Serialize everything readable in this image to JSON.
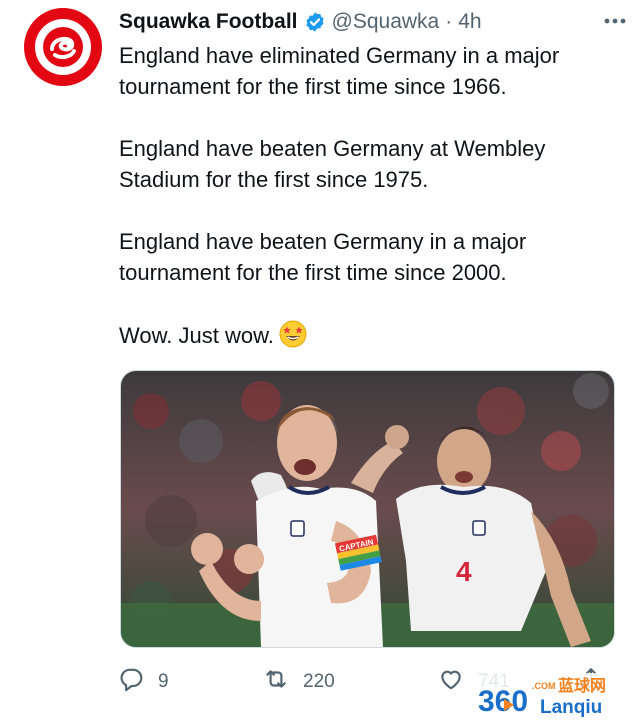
{
  "account": {
    "name": "Squawka Football",
    "handle": "@Squawka",
    "separator": "·",
    "time": "4h",
    "verified": true,
    "avatar_color": "#e30613"
  },
  "tweet": {
    "paragraphs": [
      "England have eliminated Germany in a major tournament for the first time since 1966.",
      "England have beaten Germany at Wembley Stadium for the first since 1975.",
      "England have beaten Germany in a major tournament for the first time since 2000.",
      "Wow. Just wow."
    ],
    "emoji": "star-struck-emoji"
  },
  "media": {
    "alt_icon": "photo-of-two-england-players-celebrating",
    "armband_text": "CAPTAIN",
    "shirt_number": "4"
  },
  "actions": {
    "reply_count": "9",
    "retweet_count": "220",
    "like_count": "741"
  },
  "watermark": {
    "number": "360",
    "domain": ".COM",
    "chinese": "蓝球网",
    "latin": "Lanqiu"
  },
  "colors": {
    "text": "#0f1419",
    "secondary": "#536471",
    "verified": "#1d9bf0",
    "watermark_orange": "#f5821f",
    "watermark_blue": "#1a6fc9"
  }
}
